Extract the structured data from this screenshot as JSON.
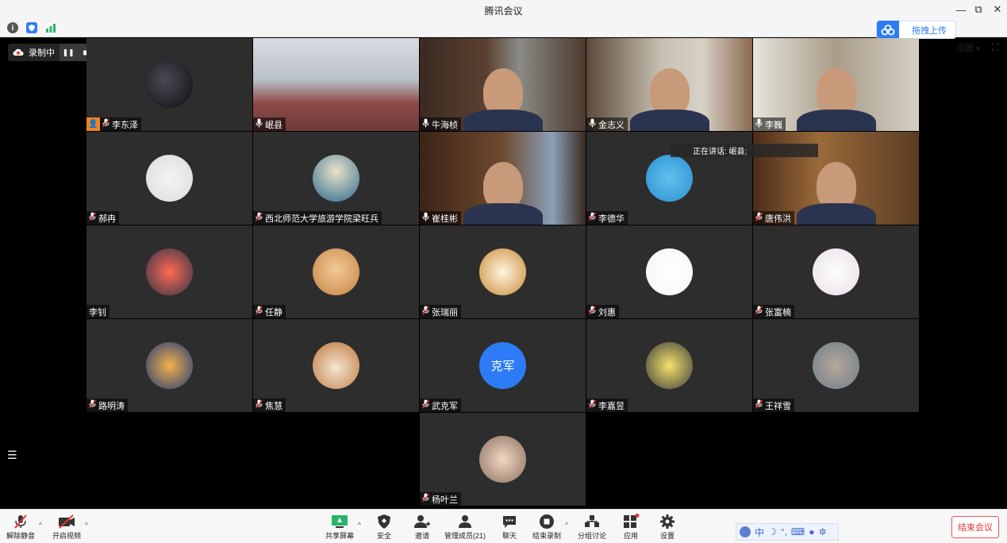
{
  "window": {
    "title": "腾讯会议",
    "minimize_icon": "—",
    "restore_icon": "⧉",
    "close_icon": "✕"
  },
  "topbar": {
    "upload_label": "拖拽上传",
    "view_label": "视图",
    "caret": "▾",
    "fullscreen_icon": "⛶"
  },
  "recording": {
    "label": "录制中",
    "pause_icon": "❚❚",
    "stop_icon": "■"
  },
  "speaking": {
    "label": "正在讲话: 岷县;"
  },
  "participants": [
    {
      "name": "李东泽",
      "type": "avatar",
      "muted": true,
      "host": true
    },
    {
      "name": "岷县",
      "type": "video",
      "muted": false
    },
    {
      "name": "牛海桢",
      "type": "video",
      "muted": false
    },
    {
      "name": "金志义",
      "type": "video",
      "muted": false
    },
    {
      "name": "李巍",
      "type": "video",
      "muted": false
    },
    {
      "name": "郝冉",
      "type": "avatar",
      "muted": true
    },
    {
      "name": "西北师范大学旅游学院梁旺兵",
      "type": "avatar",
      "muted": true
    },
    {
      "name": "崔桂彬",
      "type": "video",
      "muted": false
    },
    {
      "name": "李德华",
      "type": "avatar",
      "muted": true
    },
    {
      "name": "唐伟洪",
      "type": "video",
      "muted": true
    },
    {
      "name": "李钊",
      "type": "avatar",
      "muted": null
    },
    {
      "name": "任静",
      "type": "avatar",
      "muted": true
    },
    {
      "name": "张瑞丽",
      "type": "avatar",
      "muted": true
    },
    {
      "name": "刘惠",
      "type": "avatar",
      "muted": true
    },
    {
      "name": "张富楠",
      "type": "avatar",
      "muted": true
    },
    {
      "name": "路明涛",
      "type": "avatar",
      "muted": true
    },
    {
      "name": "焦慧",
      "type": "avatar",
      "muted": true
    },
    {
      "name": "武克军",
      "type": "text-avatar",
      "avatar_text": "克军",
      "muted": true
    },
    {
      "name": "李嘉昱",
      "type": "avatar",
      "muted": true
    },
    {
      "name": "王祥雪",
      "type": "avatar",
      "muted": true
    },
    {
      "name": "杨叶兰",
      "type": "avatar",
      "muted": true
    }
  ],
  "sidebar": {
    "list_icon": "☰"
  },
  "toolbar": {
    "unmute_label": "解除静音",
    "video_label": "开启视频",
    "share_label": "共享屏幕",
    "security_label": "安全",
    "invite_label": "邀请",
    "members_label": "管理成员(21)",
    "chat_label": "聊天",
    "end_record_label": "结束录制",
    "breakout_label": "分组讨论",
    "apps_label": "应用",
    "settings_label": "设置",
    "end_meeting_label": "结束会议",
    "caret": "^",
    "ime_text": "中"
  },
  "colors": {
    "tile_bg": "#2d2d2d",
    "accent_blue": "#2d7cf6",
    "end_red": "#e33333",
    "host_orange": "#f5821f"
  }
}
